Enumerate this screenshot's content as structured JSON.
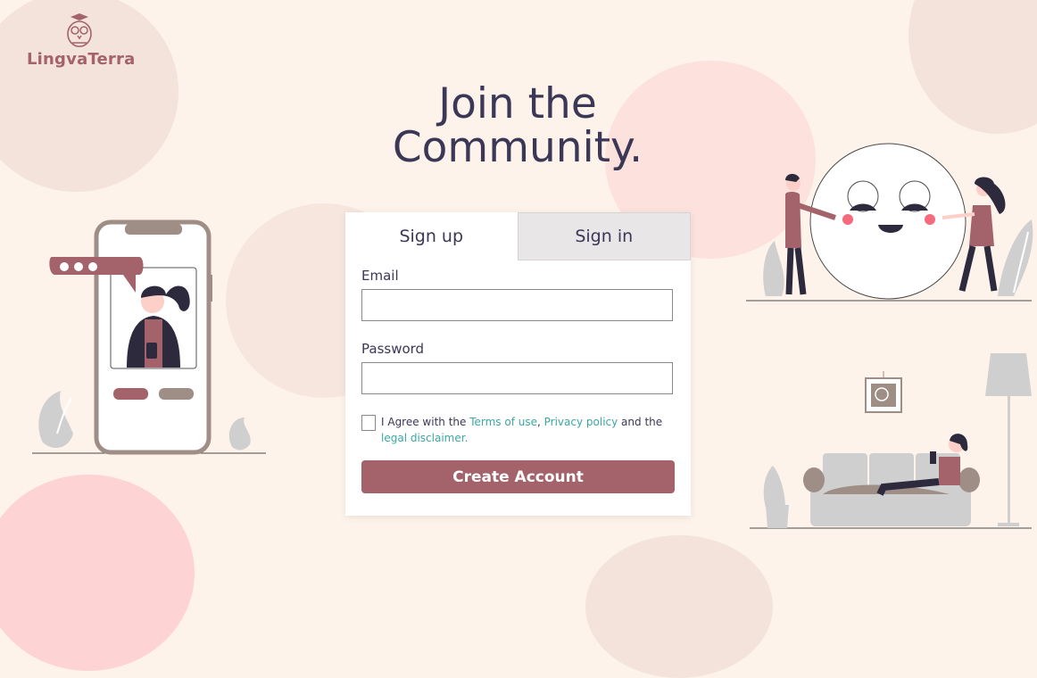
{
  "brand": {
    "name": "LingvaTerra"
  },
  "hero": {
    "title_line1": "Join the",
    "title_line2": "Community."
  },
  "auth": {
    "tabs": [
      {
        "label": "Sign up",
        "active": true
      },
      {
        "label": "Sign in",
        "active": false
      }
    ],
    "email_label": "Email",
    "email_value": "",
    "password_label": "Password",
    "password_value": "",
    "agree": {
      "checked": false,
      "text_prefix": "I Agree with the ",
      "terms_link": "Terms of use",
      "comma": ", ",
      "privacy_link": "Privacy policy",
      "and_text": " and the",
      "disclaimer_link": "legal disclaimer."
    },
    "submit_label": "Create Account"
  },
  "colors": {
    "background": "#fdf3ea",
    "accent": "#a4626a",
    "link": "#3ba8a2",
    "text": "#3b3756",
    "tab_inactive": "#e8e6e6"
  },
  "illustrations": [
    "phone-chat-illustration",
    "friends-moon-illustration",
    "couch-relax-illustration",
    "owl-logo-icon"
  ]
}
